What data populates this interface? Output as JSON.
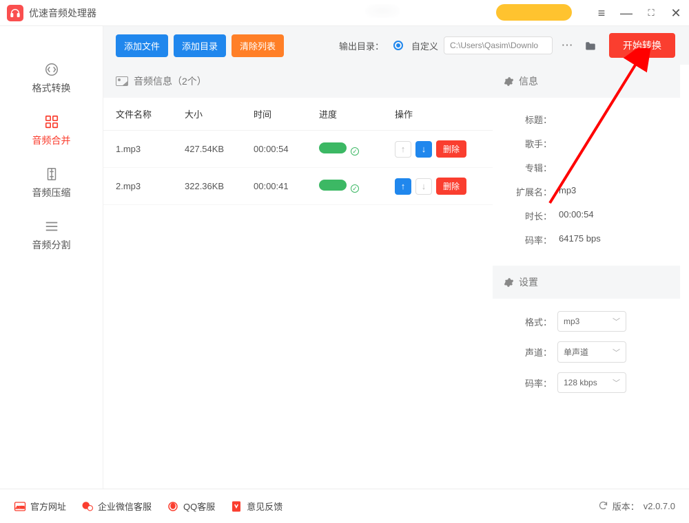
{
  "app_title": "优速音频处理器",
  "toolbar": {
    "add_file": "添加文件",
    "add_dir": "添加目录",
    "clear_list": "清除列表",
    "output_label": "输出目录：",
    "custom_label": "自定义",
    "path_value": "C:\\Users\\Qasim\\Downlo",
    "start": "开始转换"
  },
  "sidebar": {
    "items": [
      {
        "label": "格式转换"
      },
      {
        "label": "音频合并"
      },
      {
        "label": "音频压缩"
      },
      {
        "label": "音频分割"
      }
    ]
  },
  "list": {
    "header": "音频信息（2个）",
    "columns": {
      "name": "文件名称",
      "size": "大小",
      "time": "时间",
      "progress": "进度",
      "op": "操作"
    },
    "rows": [
      {
        "name": "1.mp3",
        "size": "427.54KB",
        "time": "00:00:54",
        "up_disabled": true
      },
      {
        "name": "2.mp3",
        "size": "322.36KB",
        "time": "00:00:41",
        "up_disabled": false
      }
    ],
    "delete_label": "删除"
  },
  "info": {
    "header": "信息",
    "rows": {
      "title": {
        "k": "标题：",
        "v": ""
      },
      "artist": {
        "k": "歌手：",
        "v": ""
      },
      "album": {
        "k": "专辑：",
        "v": ""
      },
      "ext": {
        "k": "扩展名：",
        "v": "mp3"
      },
      "duration": {
        "k": "时长：",
        "v": "00:00:54"
      },
      "bitrate": {
        "k": "码率：",
        "v": "64175 bps"
      }
    }
  },
  "settings": {
    "header": "设置",
    "format": {
      "k": "格式：",
      "v": "mp3"
    },
    "channel": {
      "k": "声道：",
      "v": "单声道"
    },
    "bitrate": {
      "k": "码率：",
      "v": "128 kbps"
    }
  },
  "footer": {
    "site": "官方网址",
    "wechat": "企业微信客服",
    "qq": "QQ客服",
    "feedback": "意见反馈",
    "version_label": "版本：",
    "version": "v2.0.7.0"
  }
}
